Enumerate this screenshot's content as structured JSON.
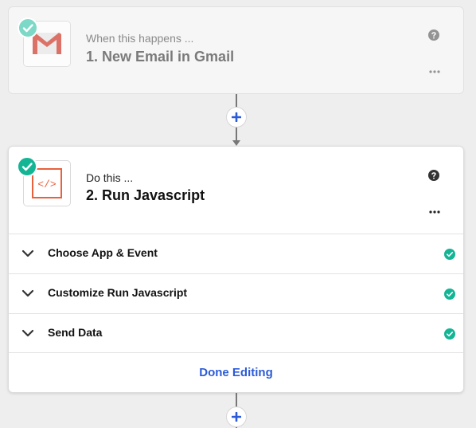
{
  "trigger_step": {
    "subtitle": "When this happens ...",
    "title": "1. New Email in Gmail",
    "app_icon": "gmail-icon",
    "status": "complete"
  },
  "action_step": {
    "subtitle": "Do this ...",
    "title": "2. Run Javascript",
    "app_icon": "code-icon",
    "status": "complete",
    "sections": [
      {
        "label": "Choose App & Event",
        "complete": true
      },
      {
        "label": "Customize Run Javascript",
        "complete": true
      },
      {
        "label": "Send Data",
        "complete": true
      }
    ],
    "done_label": "Done Editing"
  },
  "colors": {
    "check_green": "#13b595",
    "check_green_faded": "#7dd9c7",
    "add_blue": "#2b5bd8",
    "code_orange": "#e8613c",
    "gmail_red": "#d44638"
  }
}
